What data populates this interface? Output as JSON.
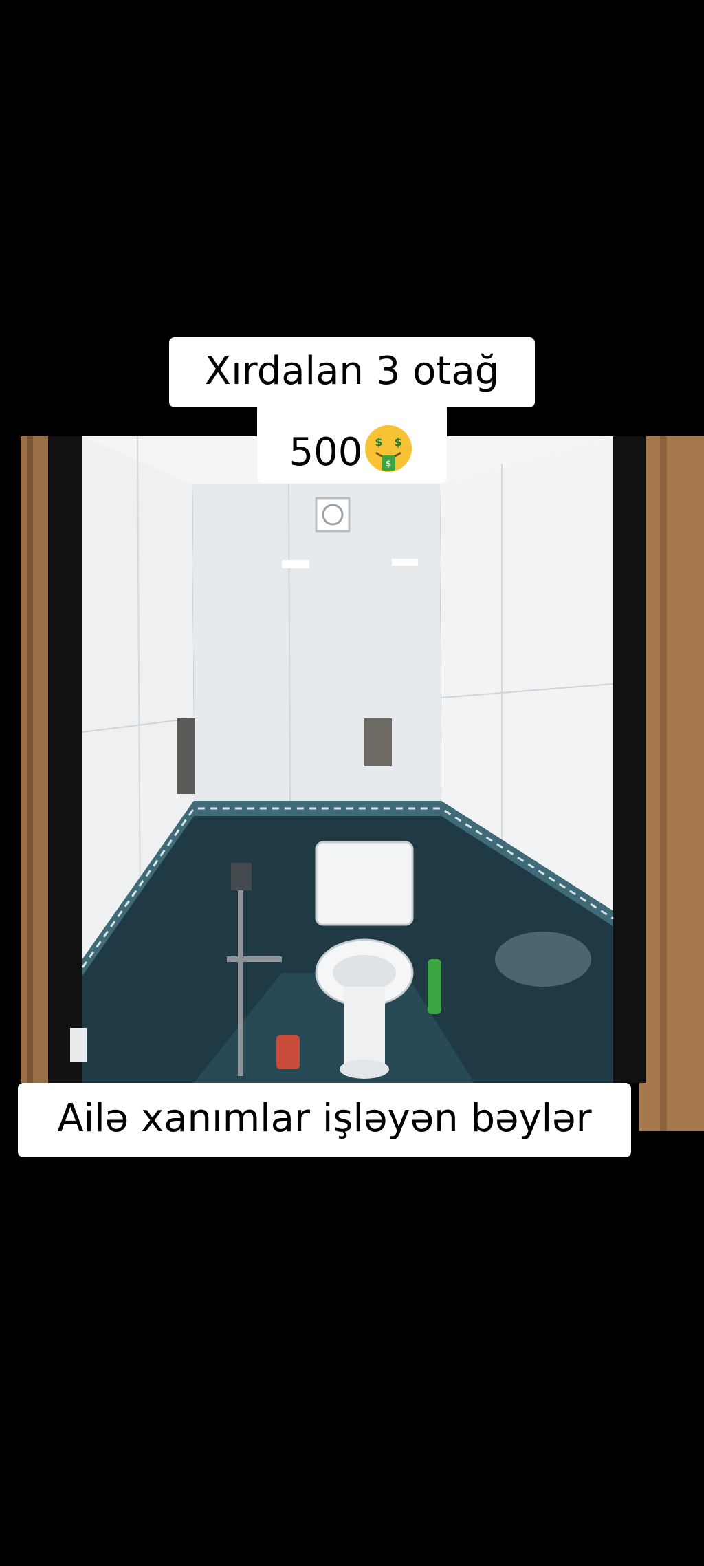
{
  "captions": {
    "top_line_1": "Xırdalan 3 otağ",
    "top_line_2_text": "500",
    "top_line_2_emoji": "money-mouth-face-icon",
    "bottom": "Ailə xanımlar işləyən bəylər"
  },
  "photo": {
    "subject": "bathroom-toilet-room-photo",
    "colors": {
      "wall_tile": "#eef0f2",
      "floor_tile": "#1f3a44",
      "door_frame": "#111111",
      "door_wood": "#9a6e46"
    }
  }
}
